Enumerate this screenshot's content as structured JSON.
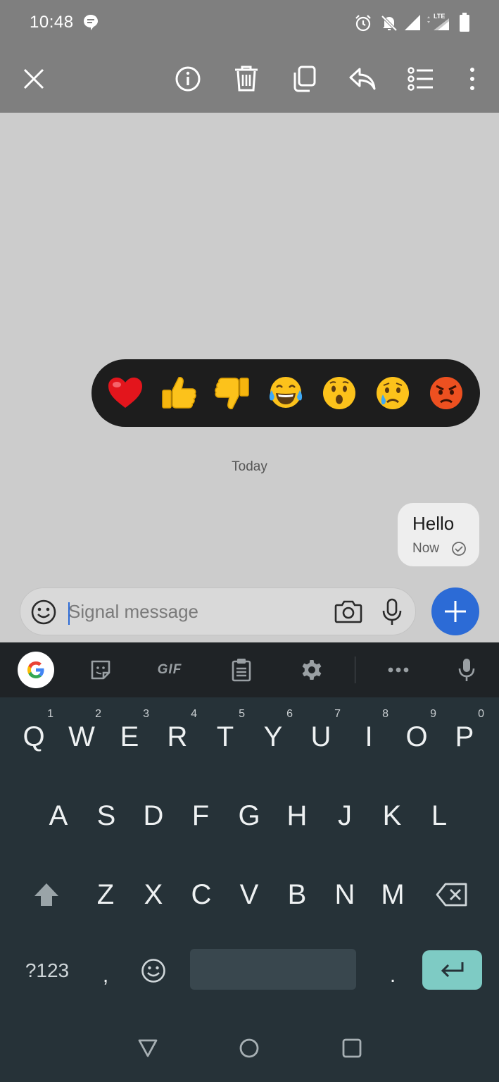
{
  "status_bar": {
    "time": "10:48",
    "icons": [
      "chat-notification-icon",
      "alarm-icon",
      "muted-bell-icon",
      "signal-icon",
      "lte-signal-icon",
      "battery-icon"
    ]
  },
  "action_bar": {
    "icons": [
      "close-icon",
      "info-icon",
      "delete-icon",
      "copy-icon",
      "reply-icon",
      "select-multiple-icon",
      "more-icon"
    ]
  },
  "reactions": [
    "❤️",
    "👍",
    "👎",
    "😂",
    "😮",
    "😢",
    "😡"
  ],
  "conversation": {
    "date_header": "Today",
    "messages": [
      {
        "text": "Hello",
        "time": "Now",
        "status": "sent-check-icon"
      }
    ]
  },
  "composer": {
    "placeholder": "Signal message",
    "value": ""
  },
  "keyboard": {
    "toolbar": {
      "gif_label": "GIF"
    },
    "row1": [
      {
        "key": "Q",
        "hint": "1"
      },
      {
        "key": "W",
        "hint": "2"
      },
      {
        "key": "E",
        "hint": "3"
      },
      {
        "key": "R",
        "hint": "4"
      },
      {
        "key": "T",
        "hint": "5"
      },
      {
        "key": "Y",
        "hint": "6"
      },
      {
        "key": "U",
        "hint": "7"
      },
      {
        "key": "I",
        "hint": "8"
      },
      {
        "key": "O",
        "hint": "9"
      },
      {
        "key": "P",
        "hint": "0"
      }
    ],
    "row2": [
      "A",
      "S",
      "D",
      "F",
      "G",
      "H",
      "J",
      "K",
      "L"
    ],
    "row3": [
      "Z",
      "X",
      "C",
      "V",
      "B",
      "N",
      "M"
    ],
    "symbols_label": "?123",
    "comma": ",",
    "period": "."
  },
  "colors": {
    "accent": "#2c6bd6",
    "enter_key": "#7ecbc4",
    "keyboard_bg": "#263238",
    "toolbar_bg": "#1f2326",
    "chrome_gray": "#7f7f7f",
    "conversation_bg": "#cccccc"
  }
}
